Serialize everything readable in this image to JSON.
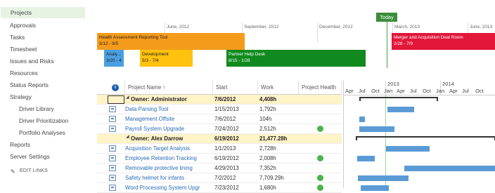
{
  "nav": {
    "items": [
      {
        "label": "Projects",
        "selected": true,
        "indent": 0
      },
      {
        "label": "Approvals",
        "indent": 0
      },
      {
        "label": "Tasks",
        "indent": 0
      },
      {
        "label": "Timesheet",
        "indent": 0
      },
      {
        "label": "Issues and Risks",
        "indent": 0
      },
      {
        "label": "Resources",
        "indent": 0
      },
      {
        "label": "Status Reports",
        "indent": 0
      },
      {
        "label": "Strategy",
        "indent": 0
      },
      {
        "label": "Driver Library",
        "indent": 1
      },
      {
        "label": "Driver Prioritization",
        "indent": 1
      },
      {
        "label": "Portfolio Analyses",
        "indent": 1
      },
      {
        "label": "Reports",
        "indent": 0
      },
      {
        "label": "Server Settings",
        "indent": 0
      }
    ],
    "edit_links": "EDIT LINKS"
  },
  "timeline": {
    "today_label": "Today",
    "dates": [
      "June, 2012",
      "September, 2012",
      "December, 2012",
      "March, 2013",
      "June, 2013"
    ],
    "bars": [
      {
        "name": "Health Assessment Reporting Tool",
        "dates": "3/12 - 9/5",
        "color": "#f59b1b"
      },
      {
        "name": "Merger and Acquisition Deal Room",
        "dates": "2/28 - 7/9",
        "color": "#e2173a",
        "text_color": "#fff"
      },
      {
        "name": "Analy...",
        "dates": "3/20 - 4",
        "color": "#4a9fe0"
      },
      {
        "name": "Development",
        "dates": "5/3 - 7/4",
        "color": "#ffc20e"
      },
      {
        "name": "Partner Help Desk",
        "dates": "8/15 - 1/28",
        "color": "#108a1e",
        "text_color": "#fff"
      }
    ]
  },
  "grid": {
    "headers": {
      "info": "i",
      "name": "Project Name ↑",
      "start": "Start",
      "work": "Work",
      "health": "Project Health"
    },
    "rows": [
      {
        "type": "owner",
        "name": "Owner: Administrator",
        "start": "7/6/2012",
        "work": "4,408h"
      },
      {
        "type": "project",
        "name": "Data Parsing Tool",
        "start": "1/15/2013",
        "work": "1,792h",
        "health": false
      },
      {
        "type": "project",
        "name": "Management Offsite",
        "start": "7/6/2012",
        "work": "104h",
        "health": false
      },
      {
        "type": "project",
        "name": "Payroll System Upgrade",
        "start": "7/24/2012",
        "work": "2,512h",
        "health": true
      },
      {
        "type": "owner",
        "name": "Owner: Alex Darrow",
        "start": "6/19/2012",
        "work": "21,477.28h"
      },
      {
        "type": "project",
        "name": "Acquisition Target Analysis",
        "start": "1/1/2013",
        "work": "2,728h",
        "health": false
      },
      {
        "type": "project",
        "name": "Employee Retention Tracking",
        "start": "6/19/2012",
        "work": "2,008h",
        "health": true
      },
      {
        "type": "project",
        "name": "Removable protective lining",
        "start": "4/29/2013",
        "work": "7,352h",
        "health": false
      },
      {
        "type": "project",
        "name": "Safety helmet for infants",
        "start": "7/2/2012",
        "work": "7,709.29h",
        "health": true
      },
      {
        "type": "project",
        "name": "Word Processing System Upgr",
        "start": "7/23/2012",
        "work": "1,680h",
        "health": true
      }
    ]
  },
  "gantt": {
    "years": [
      "2013",
      "2014"
    ],
    "months": [
      "Apr",
      "Jul",
      "Oct",
      "Jan",
      "Apr",
      "Jul",
      "Oct",
      "Jan",
      "Apr",
      "Jul",
      "Oct"
    ]
  },
  "colors": {
    "health": "#4bb34b",
    "gantt_bar": "#5b9bd5",
    "selected_nav": "#e6f3e3"
  }
}
